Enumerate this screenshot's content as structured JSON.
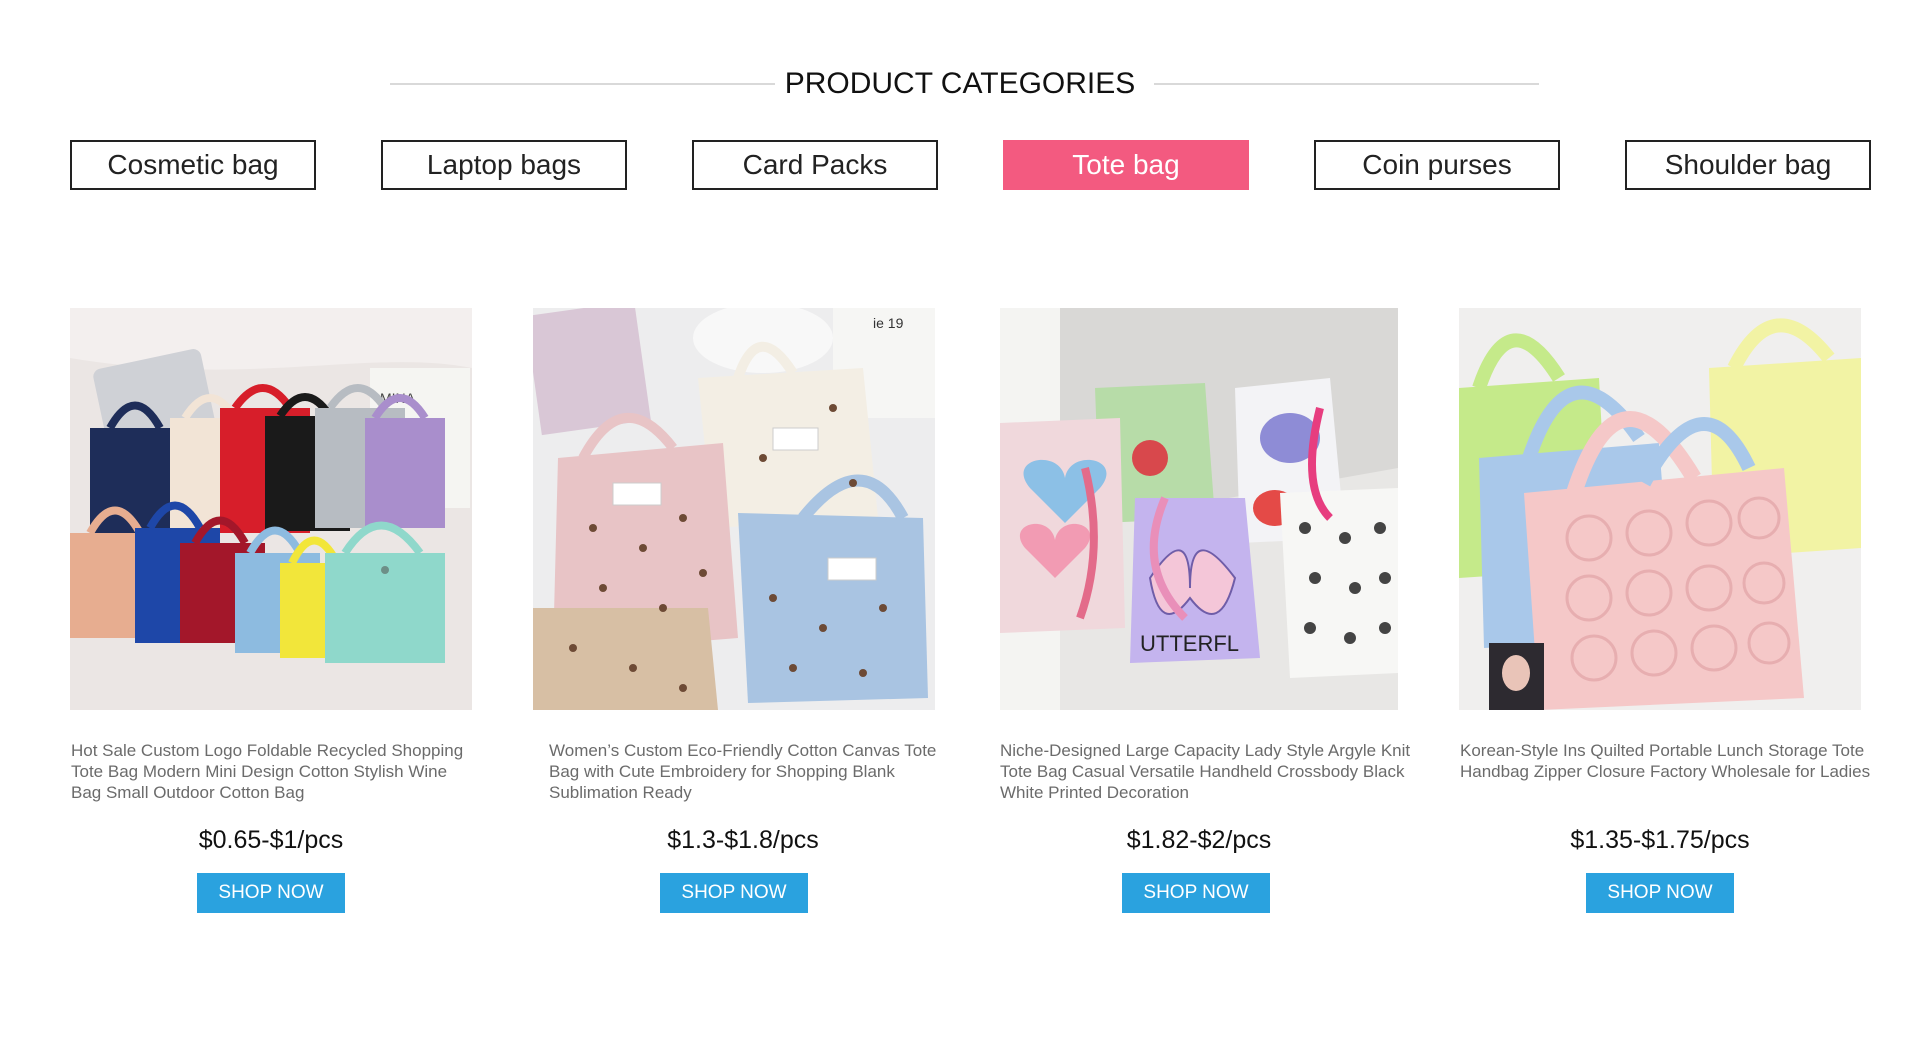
{
  "section": {
    "title": "PRODUCT CATEGORIES"
  },
  "tabs": [
    {
      "label": "Cosmetic bag",
      "active": false
    },
    {
      "label": "Laptop bags",
      "active": false
    },
    {
      "label": "Card Packs",
      "active": false
    },
    {
      "label": "Tote bag",
      "active": true
    },
    {
      "label": "Coin purses",
      "active": false
    },
    {
      "label": "Shoulder bag",
      "active": false
    }
  ],
  "colors": {
    "active_tab": "#f35a80",
    "button": "#2aa2df",
    "heading_line": "#d9d9d9",
    "title_text": "#6b6b6b"
  },
  "products": [
    {
      "title": "Hot Sale Custom Logo Foldable Recycled Shopping Tote Bag Modern Mini Design Cotton Stylish Wine Bag Small Outdoor Cotton Bag",
      "price": "$0.65-$1/pcs",
      "button": "SHOP NOW",
      "image": "colorful-mini-cotton-tote-bags-photo"
    },
    {
      "title": "Women’s Custom Eco-Friendly Cotton Canvas Tote Bag with Cute Embroidery for Shopping Blank Sublimation Ready",
      "price": "$1.3-$1.8/pcs",
      "button": "SHOP NOW",
      "image": "corduroy-bear-embroidery-tote-bags-photo"
    },
    {
      "title": "Niche-Designed Large Capacity Lady Style Argyle Knit Tote Bag Casual Versatile Handheld Crossbody Black White Printed Decoration",
      "price": "$1.82-$2/pcs",
      "button": "SHOP NOW",
      "image": "knit-printed-tote-bags-photo"
    },
    {
      "title": "Korean-Style Ins Quilted Portable Lunch Storage Tote Handbag Zipper Closure Factory Wholesale for Ladies",
      "price": "$1.35-$1.75/pcs",
      "button": "SHOP NOW",
      "image": "quilted-puffy-tote-bags-photo"
    }
  ]
}
